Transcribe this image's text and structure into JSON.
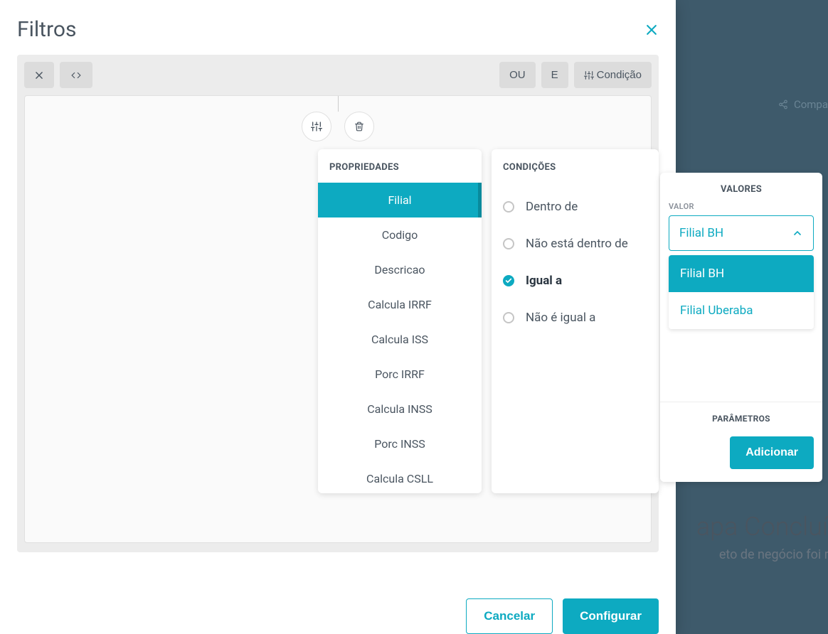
{
  "modal": {
    "title": "Filtros",
    "toolbar": {
      "ou": "OU",
      "e": "E",
      "condicao": "Condição"
    },
    "footer": {
      "cancel": "Cancelar",
      "confirm": "Configurar"
    }
  },
  "properties": {
    "title": "PROPRIEDADES",
    "items": [
      "Filial",
      "Codigo",
      "Descricao",
      "Calcula IRRF",
      "Calcula ISS",
      "Porc IRRF",
      "Calcula INSS",
      "Porc INSS",
      "Calcula CSLL"
    ],
    "selected": "Filial"
  },
  "conditions": {
    "title": "CONDIÇÕES",
    "items": [
      "Dentro de",
      "Não está dentro de",
      "Igual a",
      "Não é igual a"
    ],
    "selected": "Igual a"
  },
  "values": {
    "title": "VALORES",
    "label": "VALOR",
    "selected": "Filial BH",
    "options": [
      "Filial BH",
      "Filial Uberaba"
    ]
  },
  "params": {
    "title": "PARÂMETROS",
    "add": "Adicionar"
  },
  "background": {
    "share": "Compa",
    "stage": "apa Concluíd",
    "sub": "eto de negócio foi rea"
  }
}
